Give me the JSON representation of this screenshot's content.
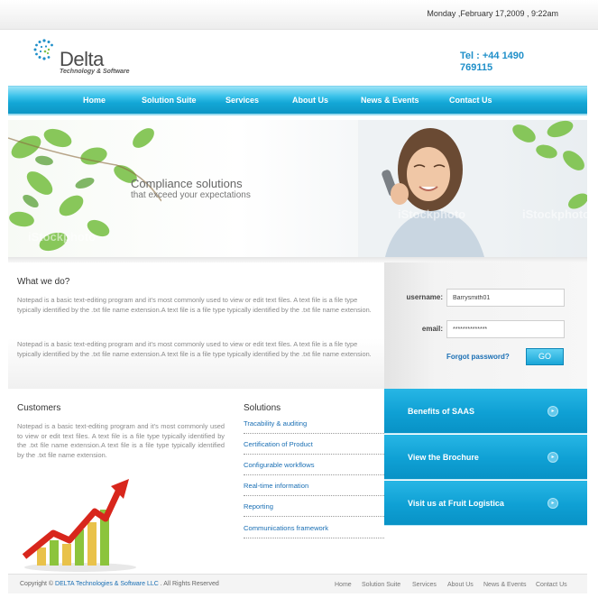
{
  "topbar": {
    "date": "Monday ,February 17,2009 , 9:22am"
  },
  "brand": {
    "name": "Delta",
    "tagline": "Technology & Software",
    "phone": "Tel : +44 1490 769115"
  },
  "nav": {
    "items": [
      "Home",
      "Solution Suite",
      "Services",
      "About Us",
      "News & Events",
      "Contact Us"
    ]
  },
  "banner": {
    "headline": "Compliance solutions",
    "subline": "that exceed your expectations",
    "watermark": "iStockphoto"
  },
  "what_we_do": {
    "title": "What we do?",
    "paragraphs": [
      "Notepad is a basic text-editing program and it's most commonly used to view or edit text files. A text file is a file type typically identified by the .txt file name extension.A text file is a file type typically identified by the .txt file name extension.",
      "Notepad is a basic text-editing program and it's most commonly used to view or edit text files. A text file is a file type typically identified by the .txt file name extension.A text file is a file type typically identified by the .txt file name extension."
    ]
  },
  "login": {
    "username_label": "username:",
    "username_value": "Barrysmith01",
    "email_label": "email:",
    "email_value": "**************",
    "forgot": "Forgot password?",
    "go": "GO"
  },
  "customers": {
    "title": "Customers",
    "text": "Notepad is a basic text-editing program and it's most commonly used to view or edit text files. A text file is a file type typically identified by the .txt file name extension.A text file is a file type typically identified by the .txt file name extension."
  },
  "solutions": {
    "title": "Solutions",
    "items": [
      "Tracability & auditing",
      "Certification of Product",
      "Configurable workflows",
      "Real-time information",
      "Reporting",
      "Communications framework"
    ]
  },
  "promo": {
    "items": [
      "Benefits of SAAS",
      "View the Brochure",
      "Visit us at Fruit Logistica"
    ]
  },
  "footer": {
    "copyright_prefix": "Copyright ©",
    "company": "DELTA Technologies & Software LLC",
    "rights": ". All Rights Reserved",
    "links": [
      "Home",
      "Solution Suite",
      "Services",
      "About Us",
      "News & Events",
      "Contact Us"
    ]
  },
  "colors": {
    "accent": "#13a7d6",
    "link": "#1a6fb4",
    "phone": "#1f8fc9"
  }
}
